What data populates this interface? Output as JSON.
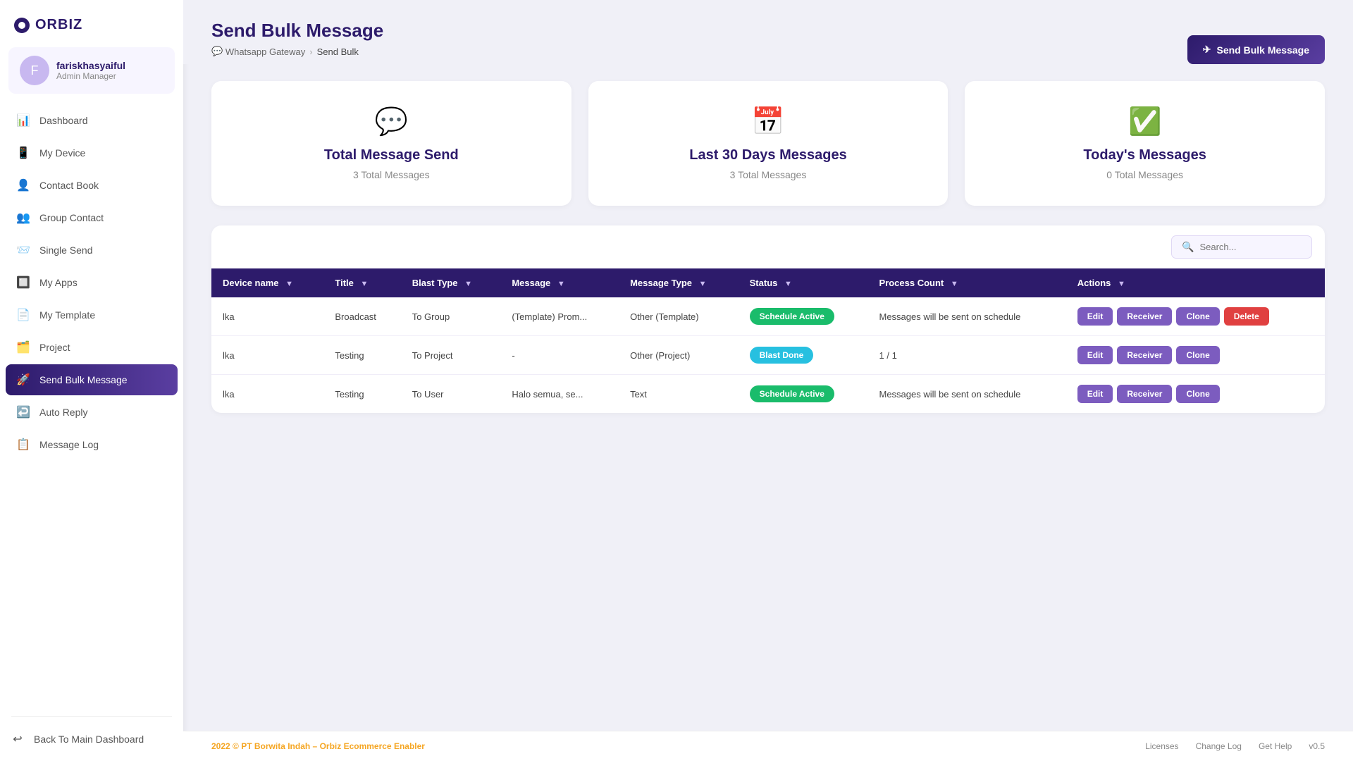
{
  "app": {
    "logo": "ORBIZ",
    "version": "v0.5"
  },
  "user": {
    "name": "fariskhasyaiful",
    "role": "Admin Manager",
    "avatar_initial": "F"
  },
  "nav": {
    "items": [
      {
        "id": "dashboard",
        "label": "Dashboard",
        "icon": "📊",
        "active": false
      },
      {
        "id": "my-device",
        "label": "My Device",
        "icon": "📱",
        "active": false
      },
      {
        "id": "contact-book",
        "label": "Contact Book",
        "icon": "👤",
        "active": false
      },
      {
        "id": "group-contact",
        "label": "Group Contact",
        "icon": "👥",
        "active": false
      },
      {
        "id": "single-send",
        "label": "Single Send",
        "icon": "📨",
        "active": false
      },
      {
        "id": "my-apps",
        "label": "My Apps",
        "icon": "🔲",
        "active": false
      },
      {
        "id": "my-template",
        "label": "My Template",
        "icon": "📄",
        "active": false
      },
      {
        "id": "project",
        "label": "Project",
        "icon": "🗂️",
        "active": false
      },
      {
        "id": "send-bulk-message",
        "label": "Send Bulk Message",
        "icon": "🚀",
        "active": true
      },
      {
        "id": "auto-reply",
        "label": "Auto Reply",
        "icon": "↩️",
        "active": false
      },
      {
        "id": "message-log",
        "label": "Message Log",
        "icon": "📋",
        "active": false
      }
    ],
    "back_label": "Back To Main Dashboard"
  },
  "header": {
    "title": "Send Bulk Message",
    "breadcrumb": {
      "parent": "Whatsapp Gateway",
      "current": "Send Bulk"
    },
    "send_btn_label": "Send Bulk Message"
  },
  "stats": [
    {
      "id": "total-message-send",
      "icon": "💬",
      "title": "Total Message Send",
      "sub": "3 Total Messages"
    },
    {
      "id": "last-30-days",
      "icon": "📅",
      "title": "Last 30 Days Messages",
      "sub": "3 Total Messages"
    },
    {
      "id": "today-messages",
      "icon": "✅",
      "title": "Today's Messages",
      "sub": "0 Total Messages"
    }
  ],
  "table": {
    "search_placeholder": "Search...",
    "columns": [
      {
        "id": "device-name",
        "label": "Device name"
      },
      {
        "id": "title",
        "label": "Title"
      },
      {
        "id": "blast-type",
        "label": "Blast Type"
      },
      {
        "id": "message",
        "label": "Message"
      },
      {
        "id": "message-type",
        "label": "Message Type"
      },
      {
        "id": "status",
        "label": "Status"
      },
      {
        "id": "process-count",
        "label": "Process Count"
      },
      {
        "id": "actions",
        "label": "Actions"
      }
    ],
    "rows": [
      {
        "device": "lka",
        "title": "Broadcast",
        "blast_type": "To Group",
        "message": "(Template) Prom...",
        "message_type": "Other (Template)",
        "status": "Schedule Active",
        "status_type": "schedule",
        "process_count": "Messages will be sent on schedule",
        "has_delete": true
      },
      {
        "device": "lka",
        "title": "Testing",
        "blast_type": "To Project",
        "message": "-",
        "message_type": "Other (Project)",
        "status": "Blast Done",
        "status_type": "blast",
        "process_count": "1 / 1",
        "has_delete": false
      },
      {
        "device": "lka",
        "title": "Testing",
        "blast_type": "To User",
        "message": "Halo semua, se...",
        "message_type": "Text",
        "status": "Schedule Active",
        "status_type": "schedule",
        "process_count": "Messages will be sent on schedule",
        "has_delete": false
      }
    ]
  },
  "footer": {
    "left": "2022 © PT Borwita Indah – ",
    "brand": "Orbiz Ecommerce Enabler",
    "links": [
      "Licenses",
      "Change Log",
      "Get Help"
    ],
    "version": "v0.5"
  }
}
